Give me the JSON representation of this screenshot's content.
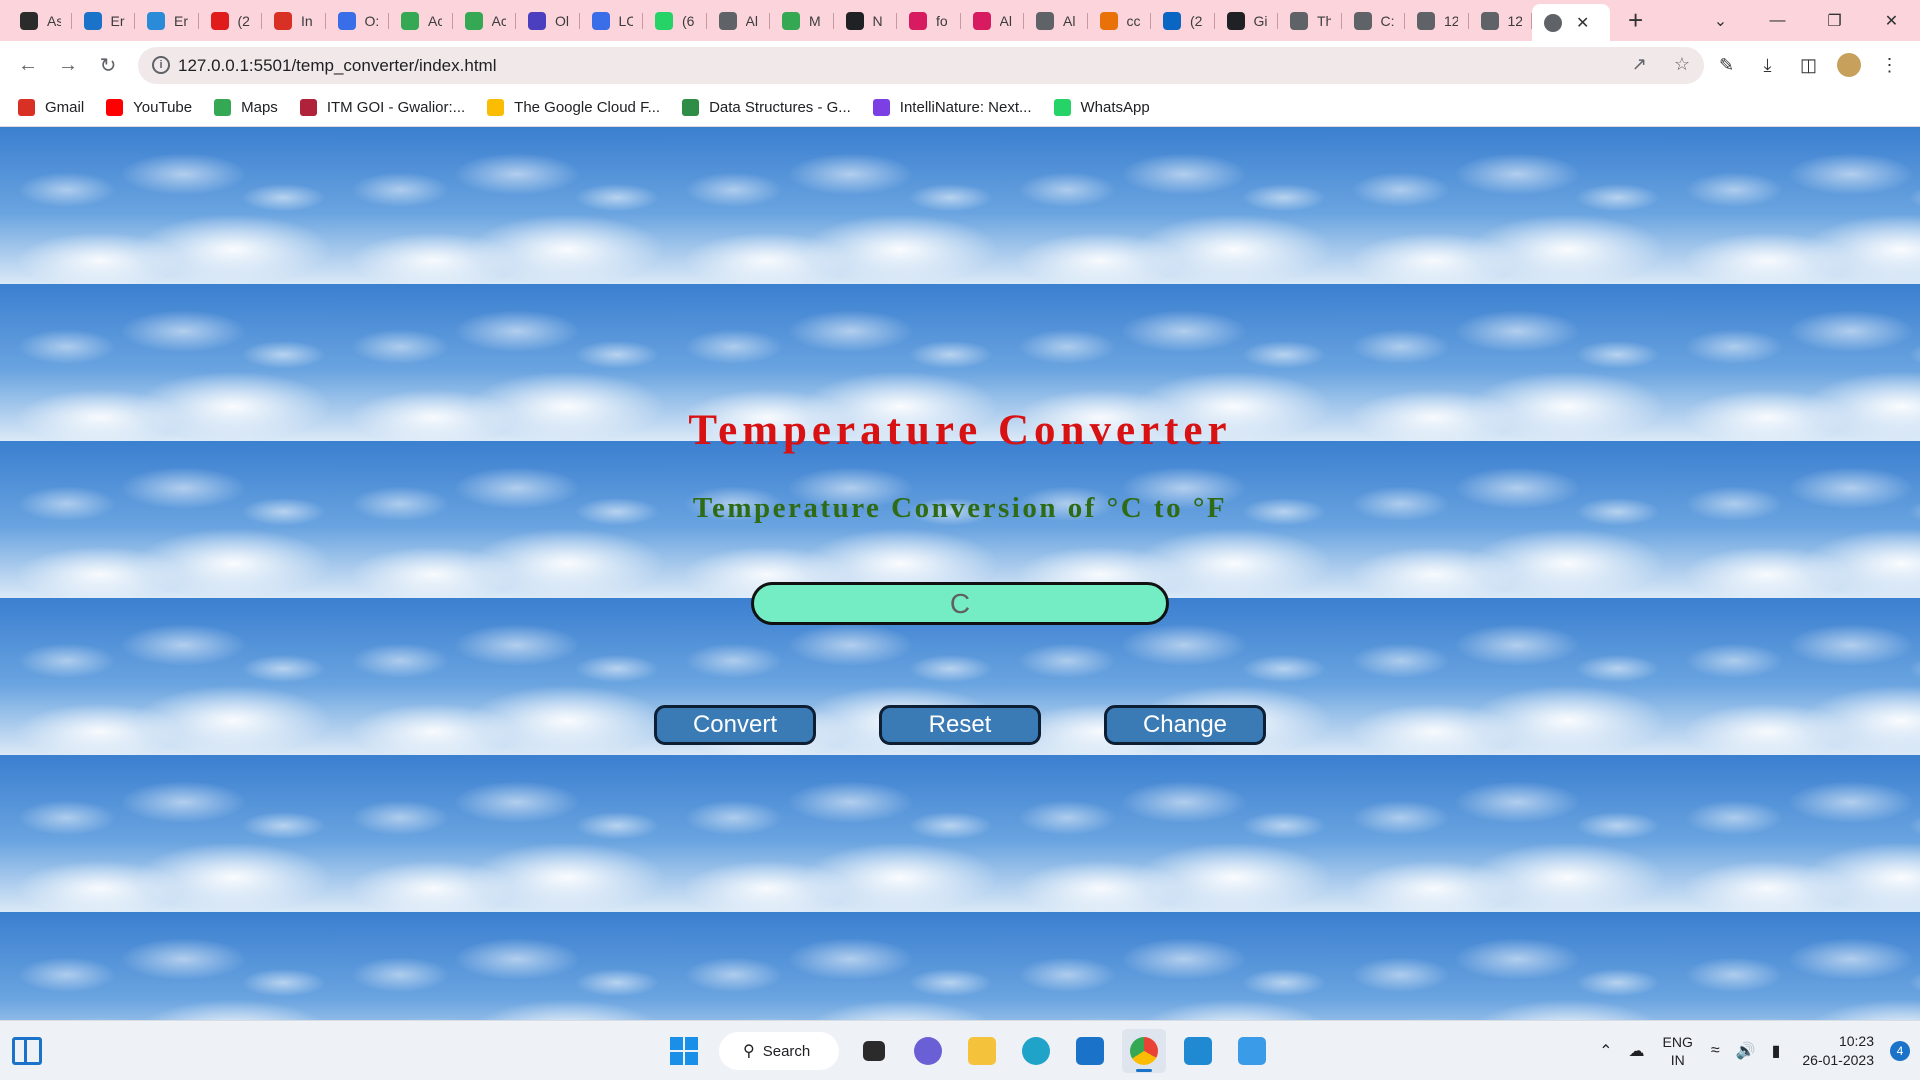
{
  "browser": {
    "tabs": [
      {
        "label": "As",
        "color": "#2b2b2b"
      },
      {
        "label": "Er",
        "color": "#1a73c8"
      },
      {
        "label": "Er",
        "color": "#2a8bd8"
      },
      {
        "label": "(2",
        "color": "#e01b1b"
      },
      {
        "label": "In",
        "color": "#d93025"
      },
      {
        "label": "O:",
        "color": "#3a6ee8"
      },
      {
        "label": "Ac",
        "color": "#34a853"
      },
      {
        "label": "Ac",
        "color": "#34a853"
      },
      {
        "label": "Ol",
        "color": "#4b3fbf"
      },
      {
        "label": "LC",
        "color": "#3a6ee8"
      },
      {
        "label": "(6",
        "color": "#25d366"
      },
      {
        "label": "Al",
        "color": "#5f6368"
      },
      {
        "label": "M",
        "color": "#34a853"
      },
      {
        "label": "N",
        "color": "#202124"
      },
      {
        "label": "fo",
        "color": "#d81b60"
      },
      {
        "label": "Al",
        "color": "#d81b60"
      },
      {
        "label": "Al",
        "color": "#5f6368"
      },
      {
        "label": "cc",
        "color": "#e8710a"
      },
      {
        "label": "(2",
        "color": "#0a66c2"
      },
      {
        "label": "Gi",
        "color": "#202124"
      },
      {
        "label": "Th",
        "color": "#5f6368"
      },
      {
        "label": "C:",
        "color": "#5f6368"
      },
      {
        "label": "12",
        "color": "#5f6368"
      },
      {
        "label": "12",
        "color": "#5f6368"
      }
    ],
    "active_tab_icon": "globe-icon",
    "new_tab": "+",
    "url": "127.0.0.1:5501/temp_converter/index.html"
  },
  "bookmarks": [
    {
      "label": "Gmail",
      "color": "#d93025"
    },
    {
      "label": "YouTube",
      "color": "#ff0000"
    },
    {
      "label": "Maps",
      "color": "#34a853"
    },
    {
      "label": "ITM GOI - Gwalior:...",
      "color": "#b0213a"
    },
    {
      "label": "The Google Cloud F...",
      "color": "#fbbc04"
    },
    {
      "label": "Data Structures - G...",
      "color": "#2f8d46"
    },
    {
      "label": "IntelliNature: Next...",
      "color": "#7b3fe4"
    },
    {
      "label": "WhatsApp",
      "color": "#25d366"
    }
  ],
  "app": {
    "title": "Temperature Converter",
    "subtitle": "Temperature Conversion of °C to °F",
    "input": {
      "placeholder": "C",
      "value": ""
    },
    "buttons": {
      "convert": "Convert",
      "reset": "Reset",
      "change": "Change"
    },
    "colors": {
      "title": "#d81212",
      "subtitle": "#2f6b15",
      "input_bg": "#74ecc4",
      "button_bg": "#3a7bb5"
    }
  },
  "taskbar": {
    "search_label": "Search",
    "language_line1": "ENG",
    "language_line2": "IN",
    "time": "10:23",
    "date": "26-01-2023",
    "notification_count": "4"
  }
}
